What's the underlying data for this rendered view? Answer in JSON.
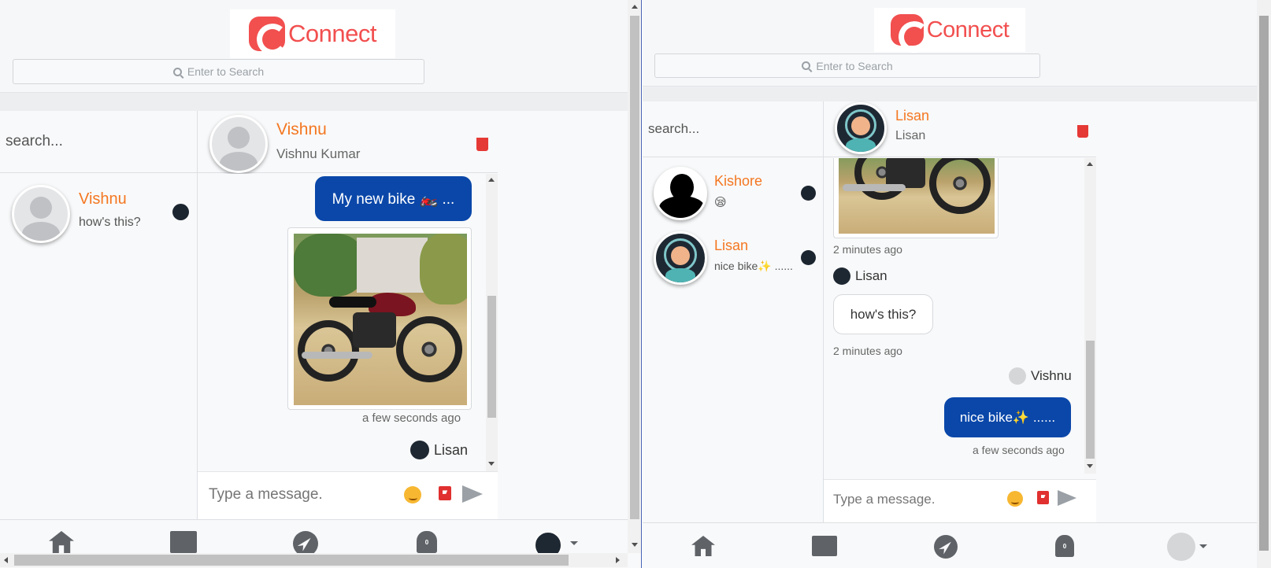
{
  "colors": {
    "accent": "#f47721",
    "brand": "#f24f4f",
    "bubble": "#0a47a9",
    "trash": "#e53935",
    "online_dot": "#1b2530"
  },
  "left_window": {
    "logo_text": "Connect",
    "top_search": {
      "placeholder": "Enter to Search"
    },
    "conversation_search": {
      "placeholder": "search..."
    },
    "contacts": [
      {
        "name": "Vishnu",
        "last_message": "how's this?",
        "avatar": "default-user-icon",
        "online": true
      }
    ],
    "chat": {
      "header": {
        "name": "Vishnu",
        "subtitle": "Vishnu Kumar"
      },
      "messages": [
        {
          "type": "text",
          "from": "me",
          "text": "My new bike 🏍️ ..."
        },
        {
          "type": "image",
          "from": "me",
          "alt": "motorcycle photo",
          "timestamp": "a few seconds ago"
        },
        {
          "type": "sender",
          "name": "Lisan"
        }
      ],
      "input": {
        "placeholder": "Type a message."
      }
    },
    "nav": [
      "home-icon",
      "chats-icon",
      "explore-icon",
      "notifications-icon",
      "profile-avatar"
    ],
    "notification_count": "0"
  },
  "right_window": {
    "logo_text": "Connect",
    "top_search": {
      "placeholder": "Enter to Search"
    },
    "conversation_search": {
      "placeholder": "search..."
    },
    "contacts": [
      {
        "name": "Kishore",
        "last_message": "😪",
        "avatar": "silhouette",
        "online": true
      },
      {
        "name": "Lisan",
        "last_message": "nice bike✨ ......",
        "avatar": "helmet-avatar",
        "online": true
      }
    ],
    "chat": {
      "header": {
        "name": "Lisan",
        "subtitle": "Lisan"
      },
      "messages": [
        {
          "type": "image",
          "from": "other",
          "alt": "motorcycle photo",
          "timestamp": "2 minutes ago"
        },
        {
          "type": "sender",
          "name": "Lisan"
        },
        {
          "type": "text",
          "from": "other",
          "text": "how's this?",
          "timestamp": "2 minutes ago"
        },
        {
          "type": "sender",
          "name": "Vishnu"
        },
        {
          "type": "text",
          "from": "me",
          "text": "nice bike✨ ......",
          "timestamp": "a few seconds ago"
        }
      ],
      "input": {
        "placeholder": "Type a message."
      }
    },
    "nav": [
      "home-icon",
      "chats-icon",
      "explore-icon",
      "notifications-icon",
      "profile-avatar"
    ],
    "notification_count": "0"
  }
}
